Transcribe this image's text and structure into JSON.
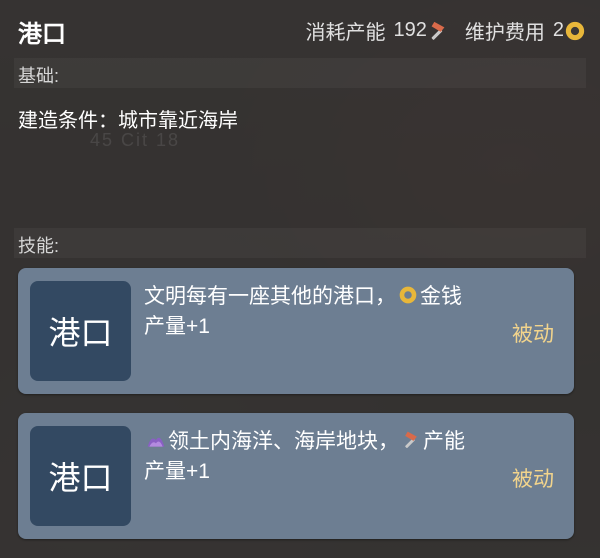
{
  "building": {
    "name": "港口",
    "production_cost_label": "消耗产能",
    "production_cost_value": "192",
    "maintenance_label": "维护费用",
    "maintenance_value": "2"
  },
  "basics": {
    "heading": "基础:",
    "requirement": "建造条件：城市靠近海岸"
  },
  "faint_background_text": "45 Cit 18",
  "skills": {
    "heading": "技能:",
    "items": [
      {
        "badge": "港口",
        "text_before": "文明每有一座其他的港口，",
        "icon": "gold-coin-icon",
        "text_after": "金钱产量+1",
        "type": "被动"
      },
      {
        "badge": "港口",
        "lead_icon": "sea-wave-icon",
        "text_before": "领土内海洋、海岸地块，",
        "icon": "production-hammer-icon",
        "text_after": "产能产量+1",
        "type": "被动"
      }
    ]
  },
  "colors": {
    "gold": "#e8b73a",
    "production": "#d96a4a",
    "passive_label": "#f2d48c",
    "card": "#6d7e92",
    "badge": "#334962"
  }
}
